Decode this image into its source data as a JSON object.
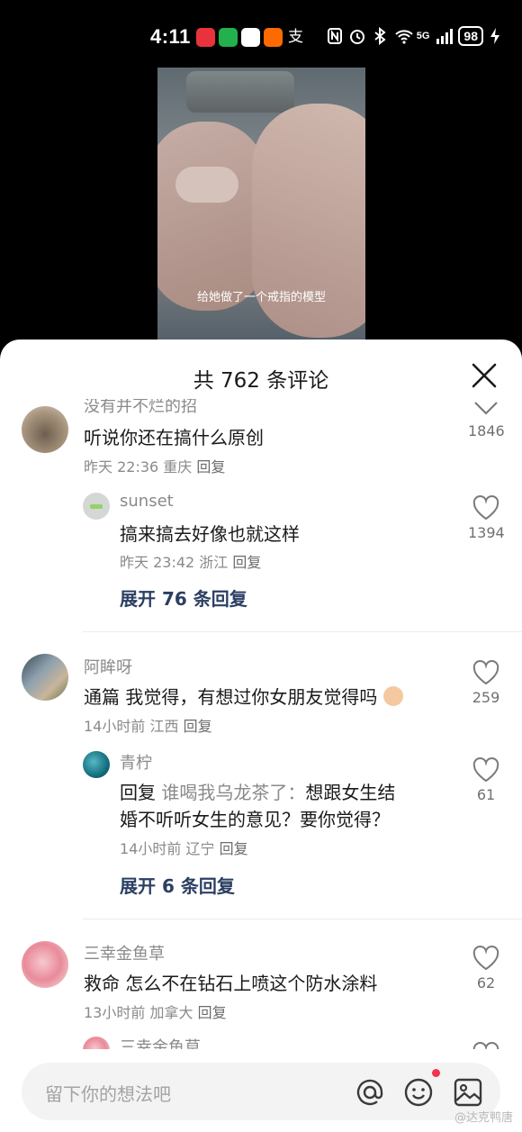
{
  "status_bar": {
    "time": "4:11",
    "battery": "98",
    "network": "5G",
    "app_icons": [
      {
        "name": "game-app-icon",
        "color": "#e8333c"
      },
      {
        "name": "wechat-icon",
        "color": "#22b14c"
      },
      {
        "name": "qq-icon",
        "color": "#ffffff"
      },
      {
        "name": "taobao-icon",
        "color": "#ff6a00"
      },
      {
        "name": "alipay-icon",
        "color": "#ffffff"
      }
    ]
  },
  "video": {
    "subtitle": "给她做了一个戒指的模型"
  },
  "comments_sheet": {
    "title": "共 762 条评论",
    "comments": [
      {
        "user": "没有并不烂的招",
        "text": "听说你还在搞什么原创",
        "time": "昨天 22:36",
        "location": "重庆",
        "reply_label": "回复",
        "likes": "1846"
      },
      {
        "user": "sunset",
        "text": "搞来搞去好像也就这样",
        "time": "昨天 23:42",
        "location": "浙江",
        "reply_label": "回复",
        "likes": "1394"
      },
      {
        "user": "阿眸呀",
        "text": "通篇 我觉得，有想过你女朋友觉得吗",
        "time": "14小时前",
        "location": "江西",
        "reply_label": "回复",
        "likes": "259"
      },
      {
        "user": "青柠",
        "reply_prefix": "回复",
        "reply_to": "谁喝我乌龙茶了：",
        "text_line1": "想跟女生结",
        "text_line2": "婚不听听女生的意见？要你觉得？",
        "time": "14小时前",
        "location": "辽宁",
        "reply_label": "回复",
        "likes": "61"
      },
      {
        "user": "三幸金鱼草",
        "text": "救命 怎么不在钻石上喷这个防水涂料",
        "time": "13小时前",
        "location": "加拿大",
        "reply_label": "回复",
        "likes": "62"
      },
      {
        "user": "三幸金鱼草"
      }
    ],
    "expand_1": "展开 76 条回复",
    "expand_2": "展开 6 条回复"
  },
  "bottom_bar": {
    "placeholder": "留下你的想法吧",
    "watermark": "@达克鸭唐"
  },
  "colors": {
    "expand_link": "#2b3f63",
    "notification_dot": "#f0344a",
    "sheet_background": "#ffffff",
    "input_background": "#f3f3f3"
  }
}
